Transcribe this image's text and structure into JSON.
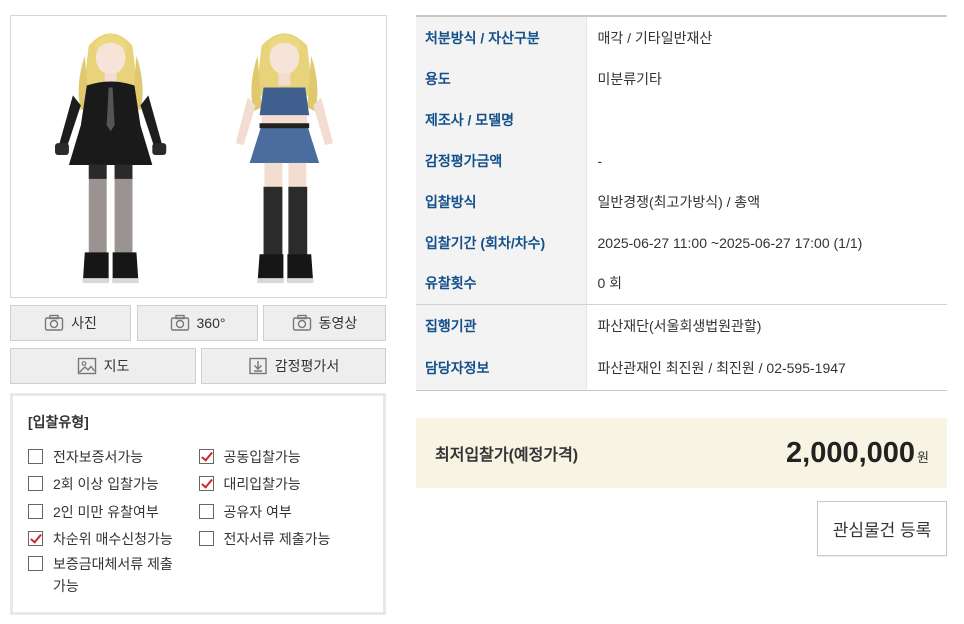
{
  "gallery": {
    "buttons": {
      "photo": "사진",
      "view360": "360°",
      "video": "동영상",
      "map": "지도",
      "appraisal": "감정평가서"
    }
  },
  "bid_type": {
    "title": "[입찰유형]",
    "options": [
      {
        "label": "전자보증서가능",
        "checked": false
      },
      {
        "label": "공동입찰가능",
        "checked": true
      },
      {
        "label": "2회 이상 입찰가능",
        "checked": false
      },
      {
        "label": "대리입찰가능",
        "checked": true
      },
      {
        "label": "2인 미만 유찰여부",
        "checked": false
      },
      {
        "label": "공유자 여부",
        "checked": false
      },
      {
        "label": "차순위 매수신청가능",
        "checked": true
      },
      {
        "label": "전자서류 제출가능",
        "checked": false
      },
      {
        "label": "보증금대체서류 제출가능",
        "checked": false
      }
    ]
  },
  "info": {
    "rows": [
      {
        "label": "처분방식 / 자산구분",
        "value": "매각 / 기타일반재산"
      },
      {
        "label": "용도",
        "value": "미분류기타"
      },
      {
        "label": "제조사 / 모델명",
        "value": ""
      },
      {
        "label": "감정평가금액",
        "value": "-"
      },
      {
        "label": "입찰방식",
        "value": "일반경쟁(최고가방식) / 총액"
      },
      {
        "label": "입찰기간 (회차/차수)",
        "value": "2025-06-27 11:00 ~2025-06-27 17:00 (1/1)"
      },
      {
        "label": "유찰횟수",
        "value": "0 회"
      },
      {
        "label": "집행기관",
        "value": "파산재단(서울회생법원관할)"
      },
      {
        "label": "담당자정보",
        "value": "파산관재인 최진원 / 최진원 / 02-595-1947"
      }
    ]
  },
  "price": {
    "label": "최저입찰가(예정가격)",
    "amount": "2,000,000",
    "unit": "원"
  },
  "favorite_button": "관심물건 등록",
  "colors": {
    "label_blue": "#134f8a",
    "check_red": "#d2262c",
    "price_bg": "#f7f4e3",
    "label_bg": "#f3f3f3"
  }
}
